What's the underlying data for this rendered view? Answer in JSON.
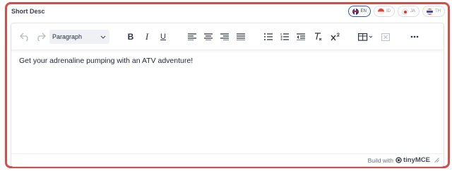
{
  "field": {
    "label": "Short Desc"
  },
  "languages": [
    {
      "code": "EN",
      "flag": "flag-en-icon",
      "active": true
    },
    {
      "code": "ID",
      "flag": "flag-id-icon",
      "active": false
    },
    {
      "code": "JA",
      "flag": "flag-ja-icon",
      "active": false
    },
    {
      "code": "TH",
      "flag": "flag-th-icon",
      "active": false
    }
  ],
  "toolbar": {
    "block_format": "Paragraph",
    "buttons": [
      "undo",
      "redo",
      "bold",
      "italic",
      "underline",
      "align-left",
      "align-center",
      "align-right",
      "align-justify",
      "bullet-list",
      "numbered-list",
      "outdent",
      "clear-formatting",
      "superscript",
      "table",
      "remove-table",
      "more"
    ],
    "bold_label": "B",
    "italic_label": "I",
    "underline_label": "U"
  },
  "editor": {
    "content": "Get your adrenaline pumping with an ATV adventure!"
  },
  "statusbar": {
    "build_with": "Build with",
    "brand": "tinyMCE"
  },
  "colors": {
    "accent_border": "#d24e46",
    "active_pill": "#2f5aa8"
  }
}
